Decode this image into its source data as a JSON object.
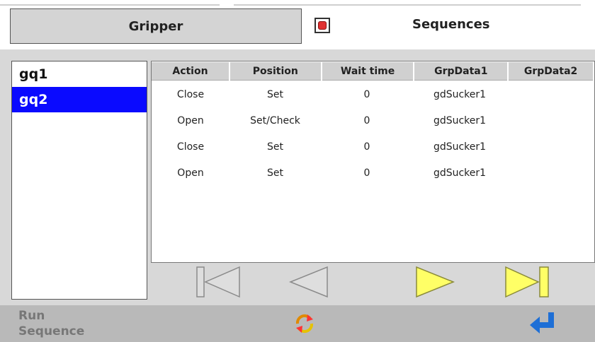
{
  "tabs": {
    "gripper_label": "Gripper",
    "sequences_label": "Sequences"
  },
  "sequence_list": [
    {
      "name": "gq1",
      "selected": false
    },
    {
      "name": "gq2",
      "selected": true
    }
  ],
  "table": {
    "columns": [
      "Action",
      "Position",
      "Wait time",
      "GrpData1",
      "GrpData2"
    ],
    "rows": [
      [
        "Close",
        "Set",
        "0",
        "gdSucker1",
        ""
      ],
      [
        "Open",
        "Set/Check",
        "0",
        "gdSucker1",
        ""
      ],
      [
        "Close",
        "Set",
        "0",
        "gdSucker1",
        ""
      ],
      [
        "Open",
        "Set",
        "0",
        "gdSucker1",
        ""
      ]
    ]
  },
  "navigation": {
    "buttons": [
      "first-icon",
      "previous-icon",
      "next-icon",
      "last-icon"
    ]
  },
  "footer": {
    "run_sequence_label": "Run Sequence",
    "icons": [
      "refresh-icon",
      "enter-icon"
    ]
  },
  "colors": {
    "selected_row": "#0a0aff",
    "disabled_nav": "#dedede",
    "enabled_nav": "#ffff66",
    "stop_red": "#e03030",
    "enter_blue": "#1e6fd6"
  }
}
